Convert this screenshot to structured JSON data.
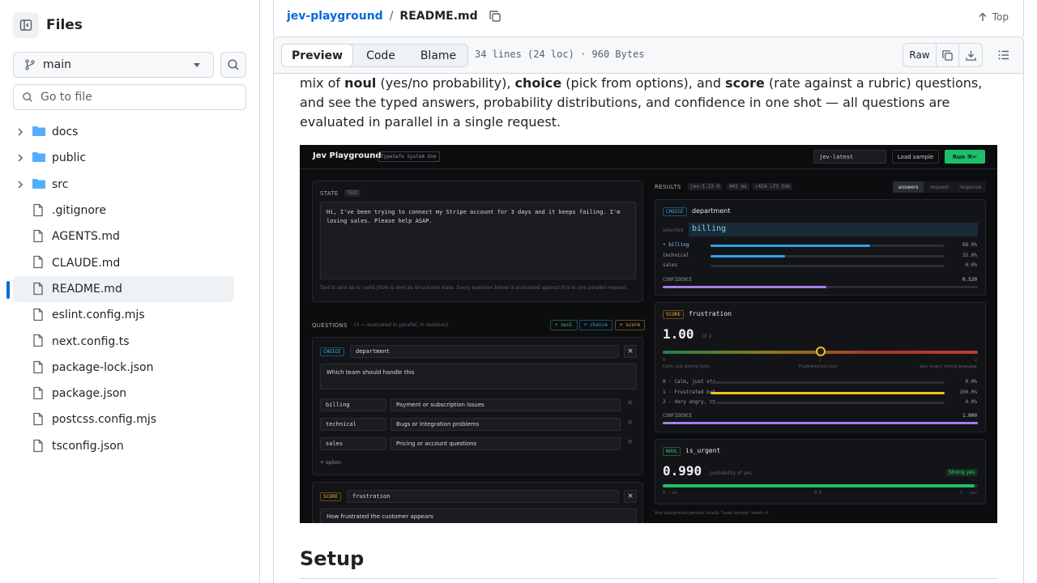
{
  "sidebar": {
    "title": "Files",
    "branch": "main",
    "goto_placeholder": "Go to file",
    "items": [
      {
        "name": "docs",
        "type": "folder"
      },
      {
        "name": "public",
        "type": "folder"
      },
      {
        "name": "src",
        "type": "folder"
      },
      {
        "name": ".gitignore",
        "type": "file"
      },
      {
        "name": "AGENTS.md",
        "type": "file"
      },
      {
        "name": "CLAUDE.md",
        "type": "file"
      },
      {
        "name": "README.md",
        "type": "file",
        "active": true
      },
      {
        "name": "eslint.config.mjs",
        "type": "file"
      },
      {
        "name": "next.config.ts",
        "type": "file"
      },
      {
        "name": "package-lock.json",
        "type": "file"
      },
      {
        "name": "package.json",
        "type": "file"
      },
      {
        "name": "postcss.config.mjs",
        "type": "file"
      },
      {
        "name": "tsconfig.json",
        "type": "file"
      }
    ]
  },
  "header": {
    "repo": "jev-playground",
    "separator": "/",
    "file": "README.md",
    "top_label": "Top"
  },
  "toolbar": {
    "tabs": [
      "Preview",
      "Code",
      "Blame"
    ],
    "active_tab": "Preview",
    "meta": "34 lines (24 loc) · 960 Bytes",
    "raw_label": "Raw"
  },
  "readme": {
    "line1_pre": "mix of ",
    "noul": "noul",
    "line1_a": " (yes/no probability), ",
    "choice": "choice",
    "line1_b": " (pick from options), and ",
    "score": "score",
    "line1_c": " (rate against a rubric) questions,",
    "line2": "and see the typed answers, probability distributions, and confidence in one shot — all questions are",
    "line3": "evaluated in parallel in a single request.",
    "heading": "Setup"
  },
  "screenshot": {
    "app_title": "Jev Playground",
    "app_badge": "TypeSafe System One",
    "model": "jev-latest",
    "load_label": "Load sample",
    "run_label": "Run ⌘↵",
    "state_label": "STATE",
    "state_tag": "TEXT",
    "state_text": "Hi, I've been trying to connect my Stripe account for 3 days and it keeps failing. I'm losing sales. Please help ASAP.",
    "state_hint": "Text is sent as-is; valid JSON is sent as structured state. Every question below is evaluated against this in one parallel request.",
    "questions_label": "QUESTIONS",
    "questions_hint": "(3 — evaluated in parallel, in isolation)",
    "add_noul": "+ noul",
    "add_choice": "+ choice",
    "add_score": "+ score",
    "q1_tag": "CHOICE",
    "q1_name": "department",
    "q1_prompt": "Which team should handle this",
    "q1_options": [
      {
        "key": "billing",
        "desc": "Payment or subscription issues"
      },
      {
        "key": "technical",
        "desc": "Bugs or integration problems"
      },
      {
        "key": "sales",
        "desc": "Pricing or account questions"
      }
    ],
    "add_option": "+ option",
    "q2_tag": "SCORE",
    "q2_name": "frustration",
    "q2_prompt": "How frustrated the customer appears",
    "results_label": "RESULTS",
    "results_tags": [
      "jev-1.13.0",
      "442 ms",
      "↑424 ↓73 tok"
    ],
    "results_tabs": [
      "answers",
      "request",
      "response"
    ],
    "r1_tag": "CHOICE",
    "r1_name": "department",
    "r1_selected_label": "selected",
    "r1_selected": "billing",
    "r1_rows": [
      {
        "label": "• billing",
        "pct": "68.0%",
        "value": 0.68
      },
      {
        "label": "technical",
        "pct": "32.0%",
        "value": 0.32
      },
      {
        "label": "sales",
        "pct": "0.0%",
        "value": 0.0
      }
    ],
    "r1_conf_label": "CONFIDENCE",
    "r1_conf": "0.520",
    "r1_conf_value": 0.52,
    "r2_tag": "SCORE",
    "r2_name": "frustration",
    "r2_value": "1.00",
    "r2_of": "of 2",
    "r2_scale": [
      "0",
      "1",
      "2"
    ],
    "r2_scale_labels": [
      "Calm, just stating facts",
      "Frustrated but civil",
      "Very angry, strong language"
    ],
    "r2_rows": [
      {
        "label": "0 · Calm, just sta…",
        "pct": "0.0%",
        "value": 0.0
      },
      {
        "label": "1 · Frustrated but…",
        "pct": "100.0%",
        "value": 1.0
      },
      {
        "label": "2 · Very angry, st…",
        "pct": "0.0%",
        "value": 0.0
      }
    ],
    "r2_conf_label": "CONFIDENCE",
    "r2_conf": "1.000",
    "r2_conf_value": 1.0,
    "r3_tag": "NOUL",
    "r3_name": "is_urgent",
    "r3_value": "0.990",
    "r3_caption": "probability of yes",
    "r3_badge": "Strong yes",
    "r3_scale": [
      "0 · no",
      "0.5",
      "1 · yes"
    ],
    "r3_fill": 0.99,
    "footer_hint": "Your playground persists locally. \"Load sample\" resets it."
  },
  "colors": {
    "accent": "#0969da",
    "green": "#1fbf6a",
    "blue_bar": "#2ea3e6",
    "yellow_bar": "#f2c21b",
    "purple": "#a97cf0"
  }
}
